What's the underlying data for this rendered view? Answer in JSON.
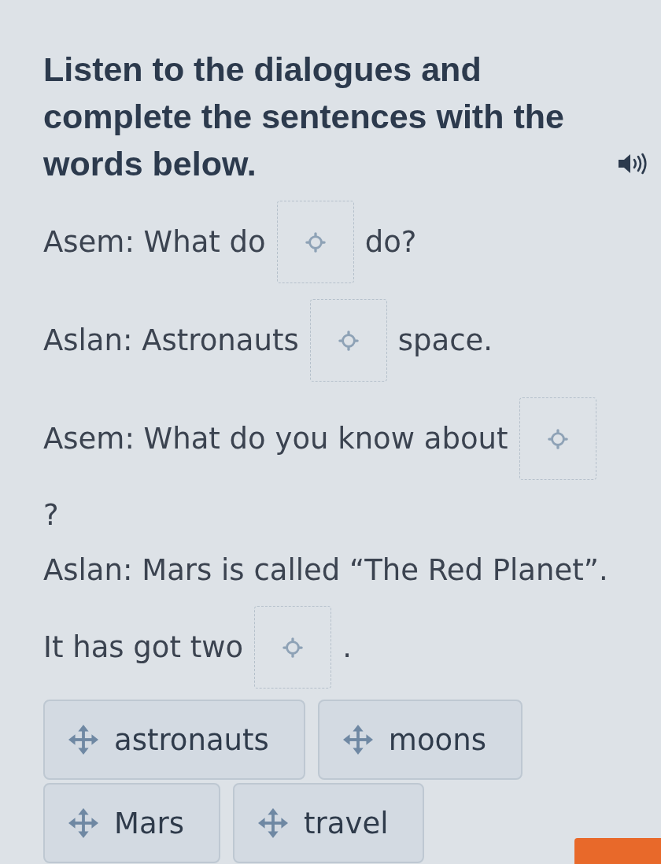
{
  "instruction": "Listen to the dialogues and complete the sentences with the words below.",
  "lines": [
    {
      "parts": [
        {
          "kind": "text",
          "text": "Asem: What do"
        },
        {
          "kind": "gap"
        },
        {
          "kind": "text",
          "text": "do?"
        }
      ]
    },
    {
      "parts": [
        {
          "kind": "text",
          "text": "Aslan: Astronauts"
        },
        {
          "kind": "gap"
        },
        {
          "kind": "text",
          "text": "space."
        }
      ]
    },
    {
      "parts": [
        {
          "kind": "text",
          "text": "Asem: What do you know about"
        },
        {
          "kind": "gap"
        }
      ]
    },
    {
      "parts": [
        {
          "kind": "text",
          "text": "?"
        }
      ]
    },
    {
      "parts": [
        {
          "kind": "text",
          "text": "Aslan: Mars is called “The Red Planet”."
        }
      ]
    },
    {
      "parts": [
        {
          "kind": "text",
          "text": "It has got two"
        },
        {
          "kind": "gap"
        },
        {
          "kind": "text",
          "text": "."
        }
      ]
    }
  ],
  "word_bank": [
    "astronauts",
    "moons",
    "Mars",
    "travel"
  ]
}
